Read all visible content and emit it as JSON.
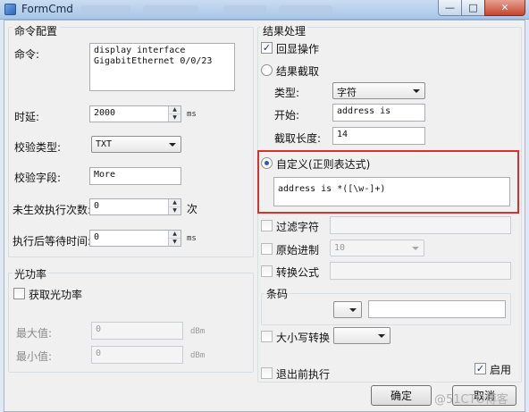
{
  "window": {
    "title": "FormCmd",
    "min_glyph": "—",
    "max_glyph": "□",
    "close_glyph": "✕"
  },
  "command_config": {
    "group_title": "命令配置",
    "command_label": "命令:",
    "command_value": "display interface\nGigabitEthernet 0/0/23",
    "delay_label": "时延:",
    "delay_value": "2000",
    "delay_unit": "ms",
    "check_type_label": "校验类型:",
    "check_type_value": "TXT",
    "check_field_label": "校验字段:",
    "check_field_value": "More",
    "retry_label": "未生效执行次数:",
    "retry_value": "0",
    "retry_unit": "次",
    "wait_label": "执行后等待时间:",
    "wait_value": "0",
    "wait_unit": "ms"
  },
  "optical_power": {
    "group_title": "光功率",
    "get_power_label": "获取光功率",
    "max_label": "最大值:",
    "max_value": "0",
    "max_unit": "dBm",
    "min_label": "最小值:",
    "min_value": "0",
    "min_unit": "dBm"
  },
  "result": {
    "group_title": "结果处理",
    "echo_label": "回显操作",
    "echo_checked": true,
    "intercept_label": "结果截取",
    "type_label": "类型:",
    "type_value": "字符",
    "start_label": "开始:",
    "start_value": "address is",
    "length_label": "截取长度:",
    "length_value": "14",
    "custom_label": "自定义(正则表达式)",
    "custom_value": "address is *([\\w-]+)",
    "filter_label": "过滤字符",
    "raw_radix_label": "原始进制",
    "raw_radix_value": "10",
    "formula_label": "转换公式",
    "barcode_label": "条码",
    "case_label": "大小写转换",
    "exit_label": "退出前执行",
    "enable_label": "启用",
    "enable_checked": true
  },
  "buttons": {
    "ok_label": "确定",
    "cancel_label": "取消"
  },
  "watermark": "@51CTO博客",
  "glyphs": {
    "check": "✓",
    "spin_up": "▲",
    "spin_down": "▼"
  },
  "colors": {
    "highlight": "#d9312b",
    "title_bar": "#a9c6e8"
  }
}
